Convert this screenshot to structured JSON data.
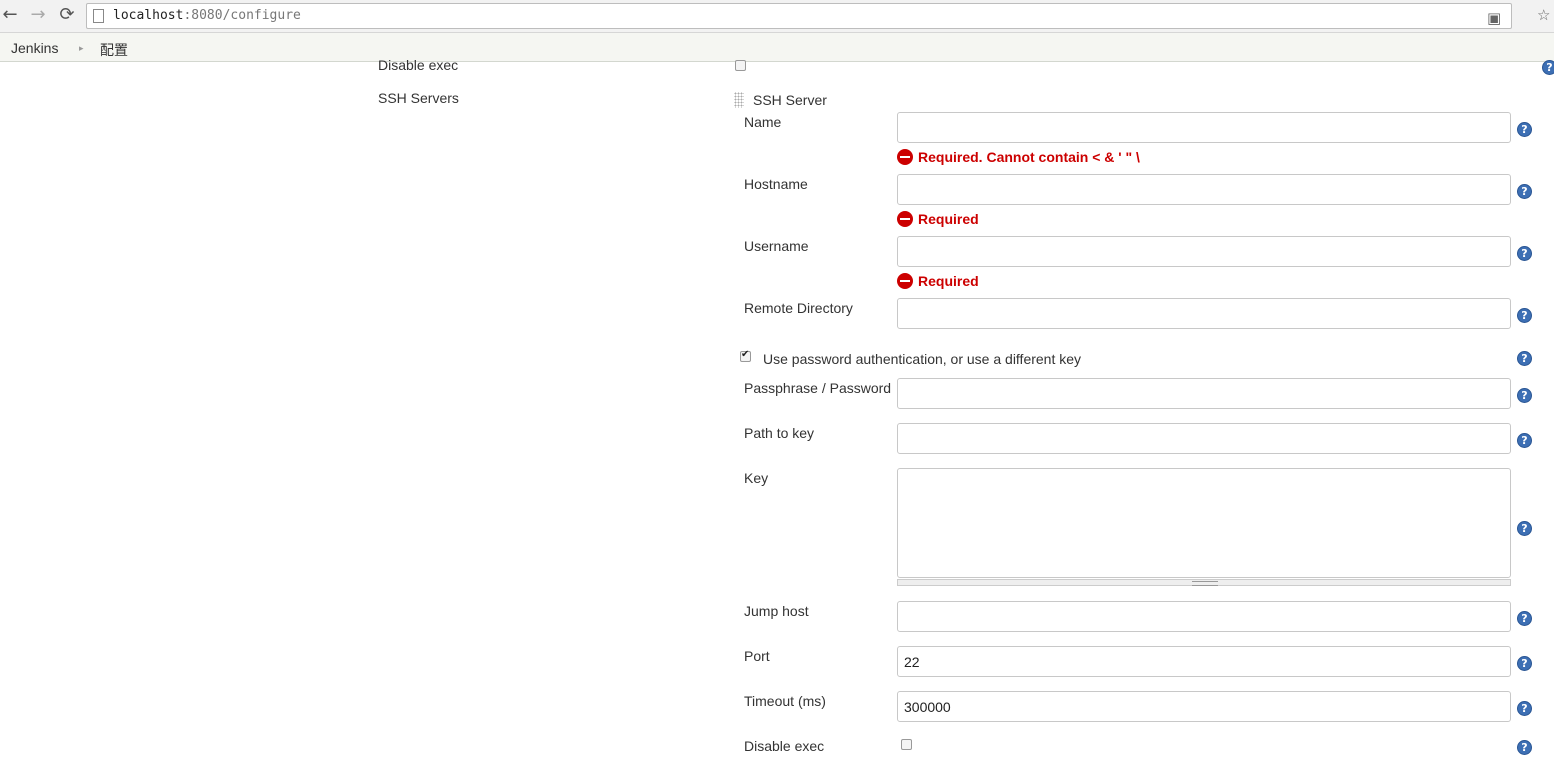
{
  "browser": {
    "url_host": "localhost",
    "url_rest": ":8080/configure",
    "back_icon": "back-arrow-icon",
    "forward_icon": "forward-arrow-icon",
    "reload_icon": "reload-icon"
  },
  "breadcrumb": {
    "items": [
      "Jenkins",
      "配置"
    ]
  },
  "form": {
    "top_disable_exec_label": "Disable exec",
    "ssh_servers_label": "SSH Servers",
    "ssh_server_heading": "SSH Server",
    "name": {
      "label": "Name",
      "value": "",
      "error": "Required. Cannot contain < & ' \" \\"
    },
    "hostname": {
      "label": "Hostname",
      "value": "",
      "error": "Required"
    },
    "username": {
      "label": "Username",
      "value": "",
      "error": "Required"
    },
    "remote_directory": {
      "label": "Remote Directory",
      "value": ""
    },
    "use_password_auth": {
      "label": "Use password authentication, or use a different key",
      "checked": true
    },
    "passphrase": {
      "label": "Passphrase / Password",
      "value": ""
    },
    "path_to_key": {
      "label": "Path to key",
      "value": ""
    },
    "key": {
      "label": "Key",
      "value": ""
    },
    "jump_host": {
      "label": "Jump host",
      "value": ""
    },
    "port": {
      "label": "Port",
      "value": "22"
    },
    "timeout": {
      "label": "Timeout (ms)",
      "value": "300000"
    },
    "disable_exec": {
      "label": "Disable exec",
      "checked": false
    },
    "help_glyph": "?"
  },
  "colors": {
    "error": "#cc0000",
    "help_icon": "#3d6fb4"
  }
}
